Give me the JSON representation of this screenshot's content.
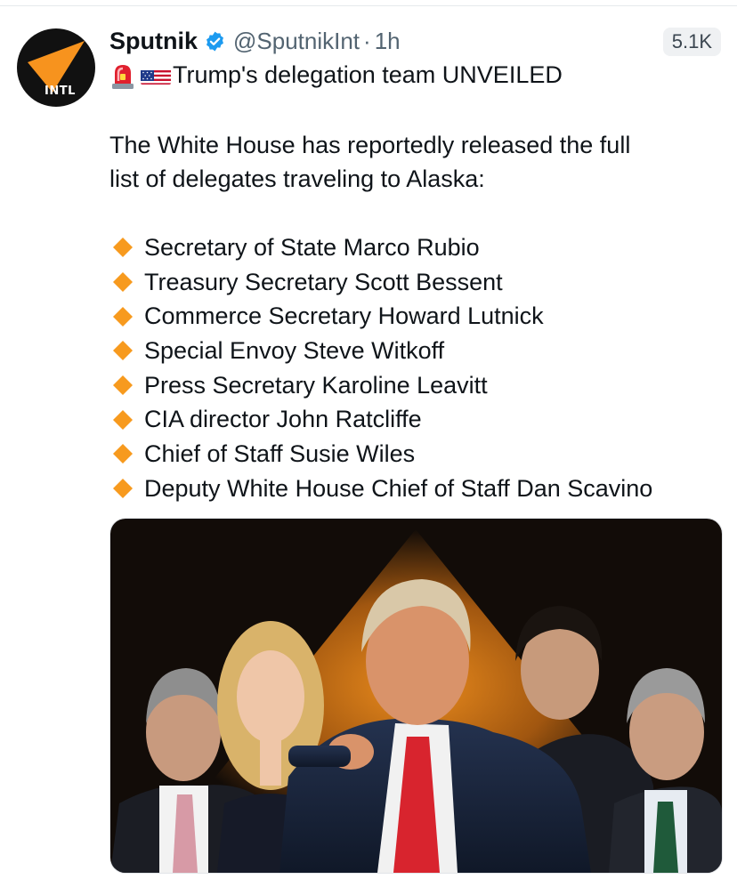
{
  "tweet": {
    "author_name": "Sputnik",
    "handle": "@SputnikInt",
    "separator": "·",
    "time": "1h",
    "views": "5.1K",
    "avatar_text": "INTL",
    "headline_emojis": [
      "rotating-light-icon",
      "us-flag-icon"
    ],
    "headline": "Trump's delegation team UNVEILED",
    "intro_line1": "The White House has reportedly released the full",
    "intro_line2": "list of delegates traveling to Alaska:",
    "bullet_icon": "orange-diamond-icon",
    "delegates": [
      "Secretary of State Marco Rubio",
      "Treasury Secretary Scott Bessent",
      "Commerce Secretary Howard Lutnick",
      "Special Envoy Steve Witkoff",
      "Press Secretary Karoline Leavitt",
      "CIA director John Ratcliffe",
      "Chief of Staff Susie Wiles",
      "Deputy White House Chief of Staff Dan Scavino"
    ]
  },
  "colors": {
    "text": "#0f1419",
    "secondary_text": "#536471",
    "verified_blue": "#1d9bf0",
    "avatar_bg": "#111111",
    "brand_orange": "#f7931e",
    "diamond_orange": "#f79a1e",
    "photo_bg": "#120c08"
  }
}
